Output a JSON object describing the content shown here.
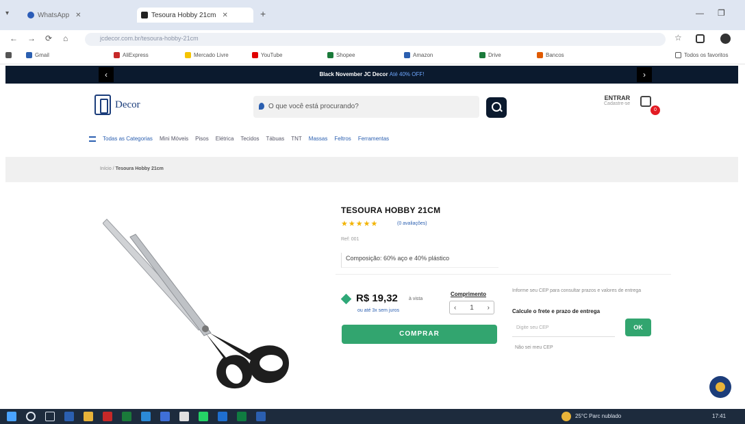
{
  "browser": {
    "tabs": [
      {
        "title": "WhatsApp"
      },
      {
        "title": "Tesoura Hobby 21cm"
      }
    ],
    "address": "jcdecor.com.br/tesoura-hobby-21cm",
    "bookmarks": [
      {
        "label": "Gmail"
      },
      {
        "label": "AliExpress"
      },
      {
        "label": "Mercado Livre"
      },
      {
        "label": "YouTube"
      },
      {
        "label": "Shopee"
      },
      {
        "label": "Amazon"
      },
      {
        "label": "Drive"
      },
      {
        "label": "Bancos"
      },
      {
        "label": "Todos os favoritos"
      }
    ]
  },
  "promo": {
    "text": "Black November JC Decor",
    "link": "Até 40% OFF!"
  },
  "header": {
    "logo_text": "Decor",
    "search_placeholder": "O que você está procurando?",
    "login_top": "ENTRAR",
    "login_sub": "Cadastre-se",
    "cart_count": "0"
  },
  "catnav": [
    "Todas as Categorias",
    "Mini Móveis",
    "Pisos",
    "Elétrica",
    "Tecidos",
    "Tábuas",
    "TNT",
    "Massas",
    "Feltros",
    "Ferramentas"
  ],
  "breadcrumb": {
    "home": "Início",
    "current": "Tesoura Hobby 21cm"
  },
  "product": {
    "title": "TESOURA HOBBY 21CM",
    "stars": "★★★★★",
    "reviews": "(0 avaliações)",
    "ref": "Ref: 001",
    "composition": "Composição: 60% aço e 40% plástico",
    "price": "R$ 19,32",
    "price_sub": "à vista",
    "installment": "ou até 3x sem juros",
    "length_label": "Comprimento",
    "quantity": "1",
    "buy_label": "COMPRAR",
    "shipping_info": "Informe seu CEP para consultar prazos e valores de entrega",
    "shipping_title": "Calcule o frete e prazo de entrega",
    "cep_placeholder": "Digite seu CEP",
    "ok_label": "OK",
    "cep_link": "Não sei meu CEP"
  },
  "taskbar": {
    "weather": "25°C Parc nublado",
    "clock": "17:41"
  },
  "colors": {
    "navy": "#0b1a2e",
    "green": "#32a56f",
    "star": "#f2b300",
    "badge": "#e31b23"
  }
}
